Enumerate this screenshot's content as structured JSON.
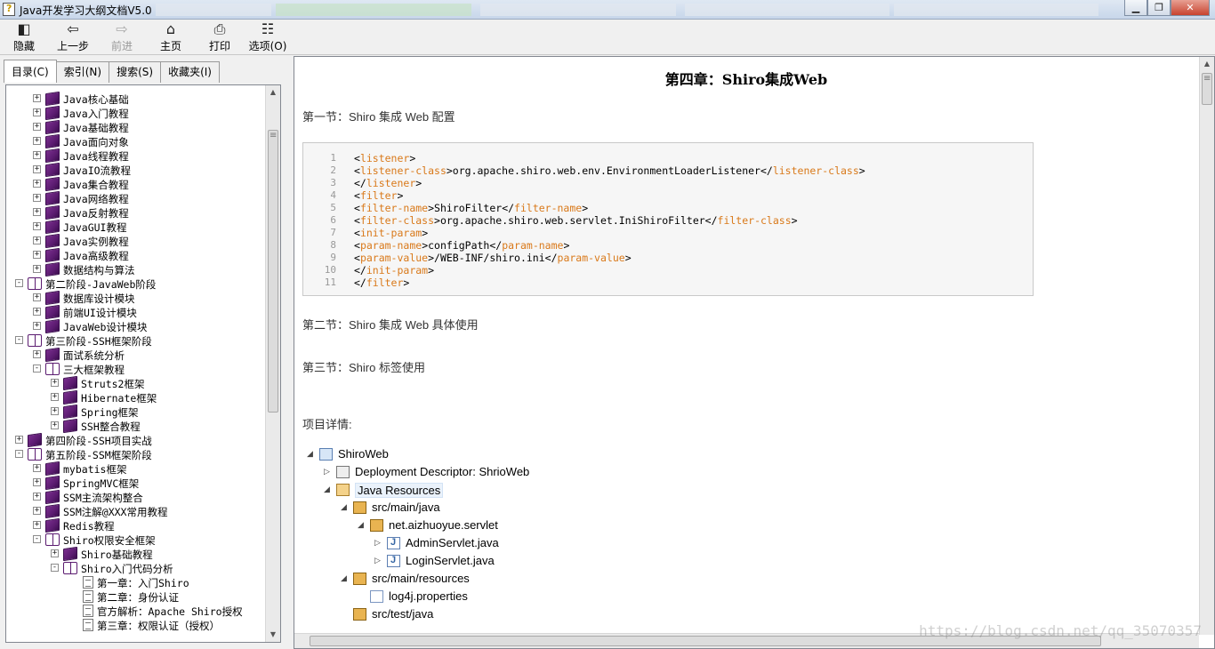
{
  "window": {
    "title": "Java开发学习大纲文档V5.0"
  },
  "toolbar": {
    "hide": "隐藏",
    "back": "上一步",
    "forward": "前进",
    "home": "主页",
    "print": "打印",
    "options": "选项(O)"
  },
  "tabs": [
    {
      "label": "目录(C)"
    },
    {
      "label": "索引(N)"
    },
    {
      "label": "搜索(S)"
    },
    {
      "label": "收藏夹(I)"
    }
  ],
  "tree": [
    {
      "label": "Java核心基础",
      "level": 1,
      "expander": "+",
      "icon": "closed"
    },
    {
      "label": "Java入门教程",
      "level": 1,
      "expander": "+",
      "icon": "closed"
    },
    {
      "label": "Java基础教程",
      "level": 1,
      "expander": "+",
      "icon": "closed"
    },
    {
      "label": "Java面向对象",
      "level": 1,
      "expander": "+",
      "icon": "closed"
    },
    {
      "label": "Java线程教程",
      "level": 1,
      "expander": "+",
      "icon": "closed"
    },
    {
      "label": "JavaIO流教程",
      "level": 1,
      "expander": "+",
      "icon": "closed"
    },
    {
      "label": "Java集合教程",
      "level": 1,
      "expander": "+",
      "icon": "closed"
    },
    {
      "label": "Java网络教程",
      "level": 1,
      "expander": "+",
      "icon": "closed"
    },
    {
      "label": "Java反射教程",
      "level": 1,
      "expander": "+",
      "icon": "closed"
    },
    {
      "label": "JavaGUI教程",
      "level": 1,
      "expander": "+",
      "icon": "closed"
    },
    {
      "label": "Java实例教程",
      "level": 1,
      "expander": "+",
      "icon": "closed"
    },
    {
      "label": "Java高级教程",
      "level": 1,
      "expander": "+",
      "icon": "closed"
    },
    {
      "label": "数据结构与算法",
      "level": 1,
      "expander": "+",
      "icon": "closed"
    },
    {
      "label": "第二阶段-JavaWeb阶段",
      "level": 0,
      "expander": "−",
      "icon": "open"
    },
    {
      "label": "数据库设计模块",
      "level": 1,
      "expander": "+",
      "icon": "closed"
    },
    {
      "label": "前端UI设计模块",
      "level": 1,
      "expander": "+",
      "icon": "closed"
    },
    {
      "label": "JavaWeb设计模块",
      "level": 1,
      "expander": "+",
      "icon": "closed"
    },
    {
      "label": "第三阶段-SSH框架阶段",
      "level": 0,
      "expander": "−",
      "icon": "open"
    },
    {
      "label": "面试系统分析",
      "level": 1,
      "expander": "+",
      "icon": "closed"
    },
    {
      "label": "三大框架教程",
      "level": 1,
      "expander": "−",
      "icon": "open"
    },
    {
      "label": "Struts2框架",
      "level": 2,
      "expander": "+",
      "icon": "closed"
    },
    {
      "label": "Hibernate框架",
      "level": 2,
      "expander": "+",
      "icon": "closed"
    },
    {
      "label": "Spring框架",
      "level": 2,
      "expander": "+",
      "icon": "closed"
    },
    {
      "label": "SSH整合教程",
      "level": 2,
      "expander": "+",
      "icon": "closed"
    },
    {
      "label": "第四阶段-SSH项目实战",
      "level": 0,
      "expander": "+",
      "icon": "closed"
    },
    {
      "label": "第五阶段-SSM框架阶段",
      "level": 0,
      "expander": "−",
      "icon": "open"
    },
    {
      "label": "mybatis框架",
      "level": 1,
      "expander": "+",
      "icon": "closed"
    },
    {
      "label": "SpringMVC框架",
      "level": 1,
      "expander": "+",
      "icon": "closed"
    },
    {
      "label": "SSM主流架构整合",
      "level": 1,
      "expander": "+",
      "icon": "closed"
    },
    {
      "label": "SSM注解@XXX常用教程",
      "level": 1,
      "expander": "+",
      "icon": "closed"
    },
    {
      "label": "Redis教程",
      "level": 1,
      "expander": "+",
      "icon": "closed"
    },
    {
      "label": "Shiro权限安全框架",
      "level": 1,
      "expander": "−",
      "icon": "open"
    },
    {
      "label": "Shiro基础教程",
      "level": 2,
      "expander": "+",
      "icon": "closed"
    },
    {
      "label": "Shiro入门代码分析",
      "level": 2,
      "expander": "−",
      "icon": "open"
    },
    {
      "label": "第一章：入门Shiro",
      "level": 3,
      "expander": "",
      "icon": "page"
    },
    {
      "label": "第二章：身份认证",
      "level": 3,
      "expander": "",
      "icon": "page"
    },
    {
      "label": "官方解析：Apache Shiro授权",
      "level": 3,
      "expander": "",
      "icon": "page"
    },
    {
      "label": "第三章：权限认证（授权）",
      "level": 3,
      "expander": "",
      "icon": "page"
    }
  ],
  "doc": {
    "title": "第四章：Shiro集成Web",
    "section1": "第一节：Shiro 集成 Web 配置",
    "section2": "第二节：Shiro 集成 Web 具体使用",
    "section3": "第三节：Shiro 标签使用",
    "project_label": "项目详情:",
    "code_lines": [
      {
        "n": "1",
        "parts": [
          [
            "p",
            "<"
          ],
          [
            "t",
            "listener"
          ],
          [
            "p",
            ">"
          ]
        ]
      },
      {
        "n": "2",
        "parts": [
          [
            "p",
            "<"
          ],
          [
            "t",
            "listener-class"
          ],
          [
            "p",
            ">org.apache.shiro.web.env.EnvironmentLoaderListener</"
          ],
          [
            "t",
            "listener-class"
          ],
          [
            "p",
            ">"
          ]
        ]
      },
      {
        "n": "3",
        "parts": [
          [
            "p",
            "</"
          ],
          [
            "t",
            "listener"
          ],
          [
            "p",
            ">"
          ]
        ]
      },
      {
        "n": "4",
        "parts": [
          [
            "p",
            "<"
          ],
          [
            "t",
            "filter"
          ],
          [
            "p",
            ">"
          ]
        ]
      },
      {
        "n": "5",
        "parts": [
          [
            "p",
            "<"
          ],
          [
            "t",
            "filter-name"
          ],
          [
            "p",
            ">ShiroFilter</"
          ],
          [
            "t",
            "filter-name"
          ],
          [
            "p",
            ">"
          ]
        ]
      },
      {
        "n": "6",
        "parts": [
          [
            "p",
            "<"
          ],
          [
            "t",
            "filter-class"
          ],
          [
            "p",
            ">org.apache.shiro.web.servlet.IniShiroFilter</"
          ],
          [
            "t",
            "filter-class"
          ],
          [
            "p",
            ">"
          ]
        ]
      },
      {
        "n": "7",
        "parts": [
          [
            "p",
            "<"
          ],
          [
            "t",
            "init-param"
          ],
          [
            "p",
            ">"
          ]
        ]
      },
      {
        "n": "8",
        "parts": [
          [
            "p",
            "<"
          ],
          [
            "t",
            "param-name"
          ],
          [
            "p",
            ">configPath</"
          ],
          [
            "t",
            "param-name"
          ],
          [
            "p",
            ">"
          ]
        ]
      },
      {
        "n": "9",
        "parts": [
          [
            "p",
            "<"
          ],
          [
            "t",
            "param-value"
          ],
          [
            "p",
            ">/WEB-INF/shiro.ini</"
          ],
          [
            "t",
            "param-value"
          ],
          [
            "p",
            ">"
          ]
        ]
      },
      {
        "n": "10",
        "parts": [
          [
            "p",
            "</"
          ],
          [
            "t",
            "init-param"
          ],
          [
            "p",
            ">"
          ]
        ]
      },
      {
        "n": "11",
        "parts": [
          [
            "p",
            "</"
          ],
          [
            "t",
            "filter"
          ],
          [
            "p",
            ">"
          ]
        ]
      }
    ],
    "project_tree": [
      {
        "label": "ShiroWeb",
        "indent": 0,
        "tri": "◢",
        "icon": "proj"
      },
      {
        "label": "Deployment Descriptor: ShrioWeb",
        "indent": 1,
        "tri": "▷",
        "icon": "dd"
      },
      {
        "label": "Java Resources",
        "indent": 1,
        "tri": "◢",
        "icon": "jr",
        "selected": true
      },
      {
        "label": "src/main/java",
        "indent": 2,
        "tri": "◢",
        "icon": "pkg"
      },
      {
        "label": "net.aizhuoyue.servlet",
        "indent": 3,
        "tri": "◢",
        "icon": "pkg"
      },
      {
        "label": "AdminServlet.java",
        "indent": 4,
        "tri": "▷",
        "icon": "java"
      },
      {
        "label": "LoginServlet.java",
        "indent": 4,
        "tri": "▷",
        "icon": "java"
      },
      {
        "label": "src/main/resources",
        "indent": 2,
        "tri": "◢",
        "icon": "pkg"
      },
      {
        "label": "log4j.properties",
        "indent": 3,
        "tri": "",
        "icon": "file"
      },
      {
        "label": "src/test/java",
        "indent": 2,
        "tri": "",
        "icon": "pkg"
      }
    ]
  },
  "watermark": "https://blog.csdn.net/qq_35070357"
}
